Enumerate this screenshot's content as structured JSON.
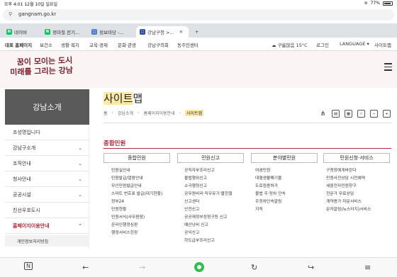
{
  "status": {
    "time": "오후 4:01",
    "date": "12월 10일 일요일",
    "battery": "77%",
    "wifi": "≋"
  },
  "browser": {
    "url": "gangnam.go.kr"
  },
  "tabs": [
    {
      "label": "네이버",
      "fav": "N",
      "color": "#03c75a"
    },
    {
      "label": "정마철 전기...",
      "fav": "N",
      "color": "#03c75a"
    },
    {
      "label": "정보마당 -...",
      "fav": "□",
      "color": "#4a7bd0"
    },
    {
      "label": "강남구청 >...",
      "fav": "□",
      "color": "#2b4aa0"
    }
  ],
  "site_nav": {
    "home": "대표 홈페이지",
    "items": [
      "보건소",
      "생활·복지",
      "교육·경제",
      "문화·관광",
      "강남구의회",
      "동주민센터"
    ],
    "weather": "구름많음 15°C",
    "login": "로그인",
    "language": "LANGUAGE",
    "sitemap": "사이트맵"
  },
  "banner": {
    "slogan_line1": "꿈이 모이는 도시",
    "slogan_line2": "미래를 그리는 강남"
  },
  "sidebar": {
    "title": "강남소개",
    "items": [
      "조성명입니다",
      "강남구소개",
      "조직안내",
      "청사안내",
      "공공시설",
      "친선우호도시",
      "홈페이지이용안내"
    ],
    "sub_item": "개인정보처리방침"
  },
  "main": {
    "title_highlight": "사이트",
    "title_rest": "맵",
    "breadcrumb": [
      "홈",
      "강남소개",
      "홈페이지이용안내",
      "사이트맵"
    ],
    "section_title": "종합민원",
    "columns": [
      {
        "title": "종합민원",
        "items": [
          "민원실안내",
          "민원발급/열람안내",
          "무인민원발급안내",
          "스마트 번호표 발급(대기현황)",
          "정부24",
          "민원현황",
          "민원서식(사무편람)",
          "온라인행정심판",
          "행정서비스헌장"
        ]
      },
      {
        "title": "민원신고",
        "items": [
          "공직자부조리신고",
          "불법행위신고",
          "소극행정신고",
          "공무원비리·직무유기·불친절",
          "신고센터",
          "안전신고",
          "공공재정부정청구등 신고",
          "예산낭비 신고",
          "공익신고",
          "하도급부조리신고"
        ]
      },
      {
        "title": "분야별민원",
        "items": [
          "여권민원",
          "대형생활폐기물",
          "도로점용허가",
          "불법 주·정차 단속",
          "주정차단속알림",
          "지적"
        ]
      },
      {
        "title": "민원신청·서비스",
        "items": [
          "구청장에게바란다",
          "민원사전상담 시전예약",
          "세움전자민원창구",
          "전문가 무료상담",
          "계약용가 자문서비스",
          "문자알림(뉴스터지)서비스"
        ]
      }
    ]
  }
}
